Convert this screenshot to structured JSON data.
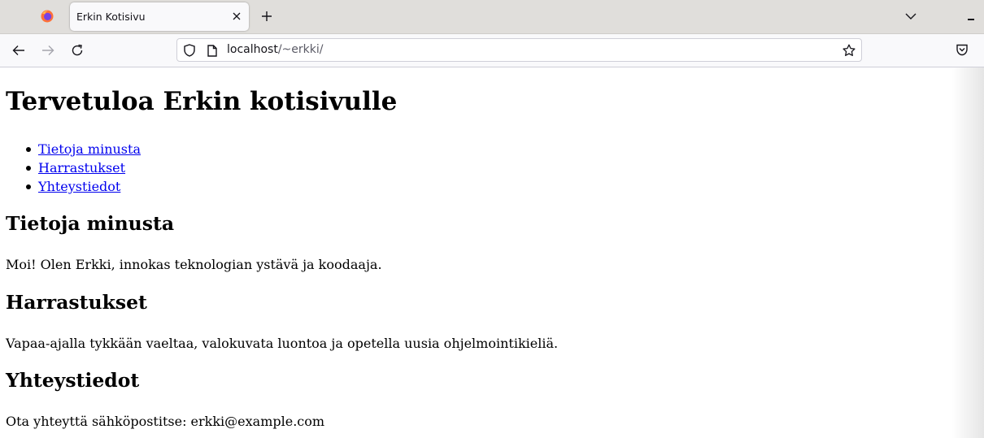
{
  "browser": {
    "tab": {
      "title": "Erkin Kotisivu"
    },
    "url": {
      "host": "localhost",
      "path": "/~erkki/"
    }
  },
  "page": {
    "heading": "Tervetuloa Erkin kotisivulle",
    "nav": [
      {
        "label": "Tietoja minusta"
      },
      {
        "label": "Harrastukset"
      },
      {
        "label": "Yhteystiedot"
      }
    ],
    "sections": [
      {
        "title": "Tietoja minusta",
        "text": "Moi! Olen Erkki, innokas teknologian ystävä ja koodaaja."
      },
      {
        "title": "Harrastukset",
        "text": "Vapaa-ajalla tykkään vaeltaa, valokuvata luontoa ja opetella uusia ohjelmointikieliä."
      },
      {
        "title": "Yhteystiedot",
        "text": "Ota yhteyttä sähköpostitse: erkki@example.com"
      }
    ]
  },
  "colors": {
    "link": "#0000ee",
    "tabstrip": "#e0dedb",
    "toolbar": "#f9f9fb"
  }
}
